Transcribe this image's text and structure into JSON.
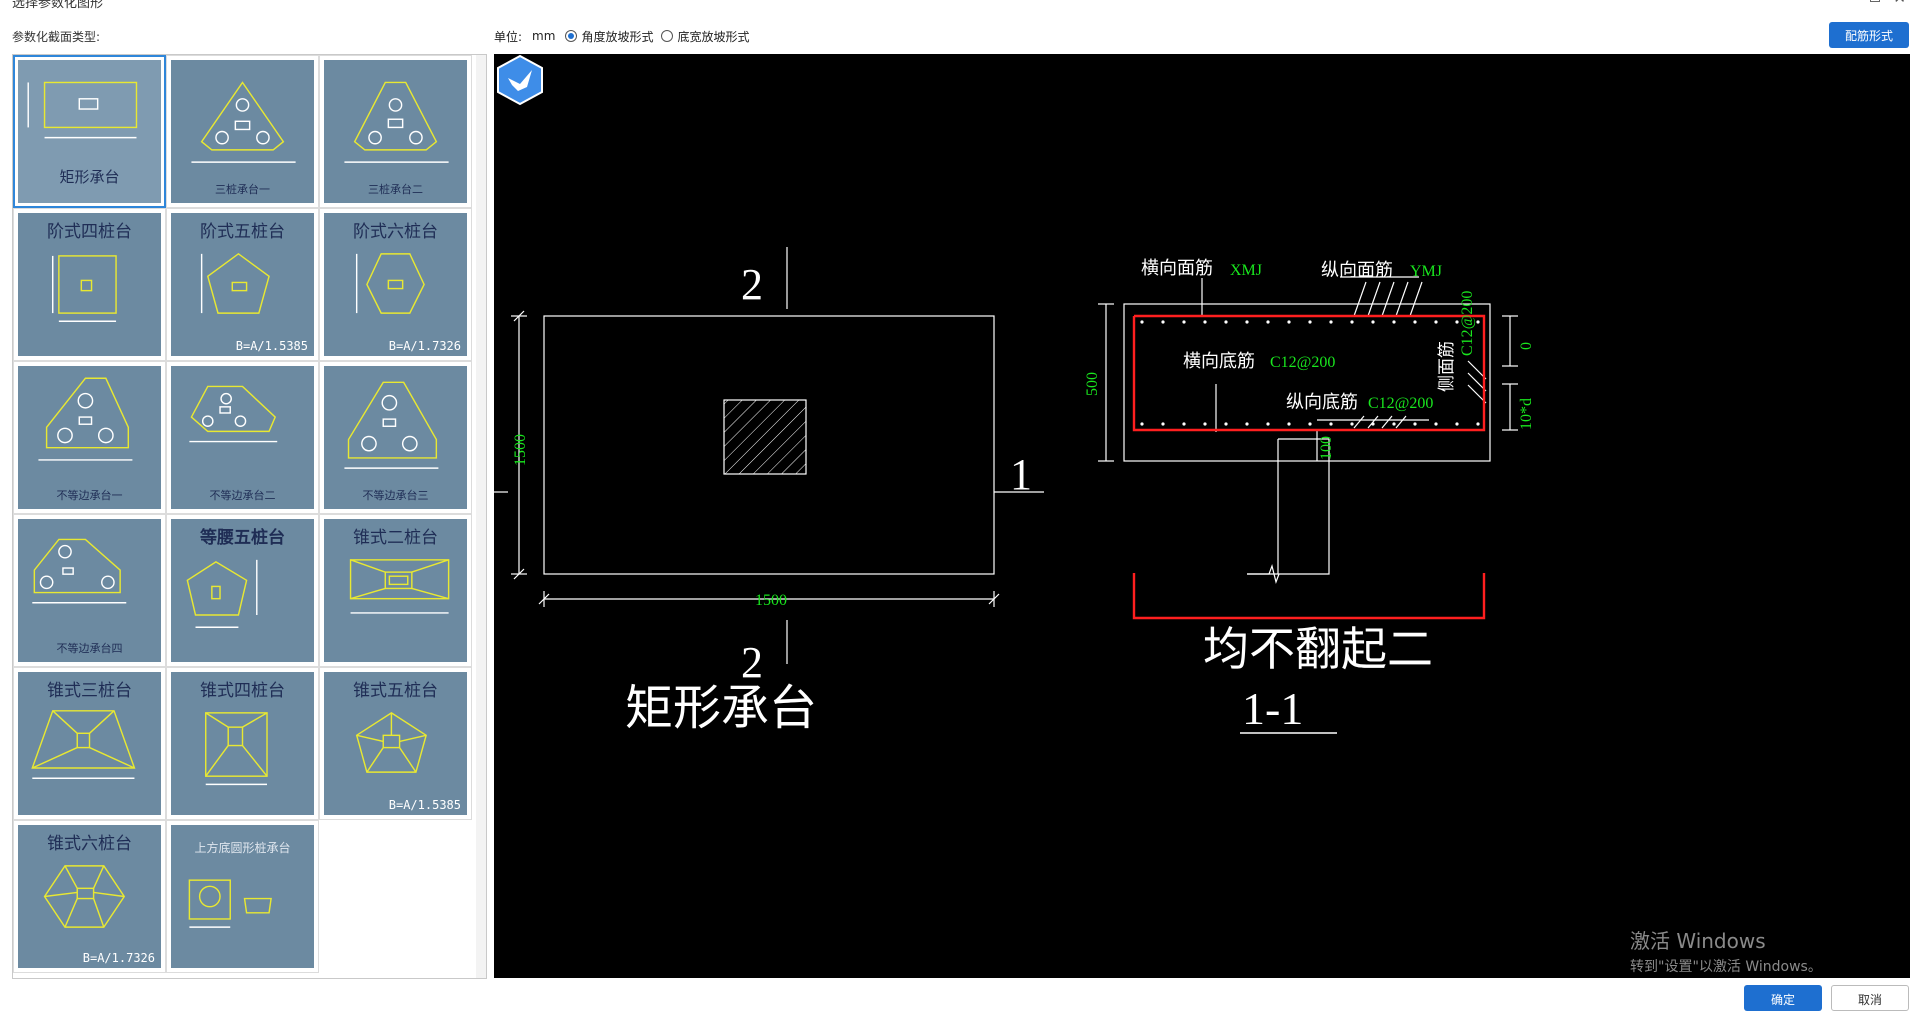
{
  "window": {
    "title": "选择参数化图形",
    "close_glyph": "✕"
  },
  "left_panel": {
    "label": "参数化截面类型:"
  },
  "gallery": [
    {
      "id": "rect",
      "label": "",
      "caption": "矩形承台",
      "formula": ""
    },
    {
      "id": "tri1",
      "label": "",
      "caption": "三桩承台一",
      "formula": ""
    },
    {
      "id": "tri2",
      "label": "",
      "caption": "三桩承台二",
      "formula": ""
    },
    {
      "id": "step4",
      "label": "阶式四桩台",
      "caption": "",
      "formula": ""
    },
    {
      "id": "step5",
      "label": "阶式五桩台",
      "caption": "",
      "formula": "B=A/1.5385"
    },
    {
      "id": "step6",
      "label": "阶式六桩台",
      "caption": "",
      "formula": "B=A/1.7326"
    },
    {
      "id": "uneq1",
      "label": "",
      "caption": "不等边承台一",
      "formula": ""
    },
    {
      "id": "uneq2",
      "label": "",
      "caption": "不等边承台二",
      "formula": ""
    },
    {
      "id": "uneq3",
      "label": "",
      "caption": "不等边承台三",
      "formula": ""
    },
    {
      "id": "uneq4",
      "label": "",
      "caption": "不等边承台四",
      "formula": ""
    },
    {
      "id": "iso5",
      "label": "等腰五桩台",
      "caption": "",
      "formula": ""
    },
    {
      "id": "cone2",
      "label": "锥式二桩台",
      "caption": "",
      "formula": ""
    },
    {
      "id": "cone3",
      "label": "锥式三桩台",
      "caption": "",
      "formula": ""
    },
    {
      "id": "cone4",
      "label": "锥式四桩台",
      "caption": "",
      "formula": ""
    },
    {
      "id": "cone5",
      "label": "锥式五桩台",
      "caption": "",
      "formula": "B=A/1.5385"
    },
    {
      "id": "cone6",
      "label": "锥式六桩台",
      "caption": "",
      "formula": "B=A/1.7326"
    },
    {
      "id": "round",
      "label": "上方底圆形桩承台",
      "caption": "",
      "formula": ""
    }
  ],
  "toolbar": {
    "unit_label": "单位:",
    "unit_value": "mm",
    "options": [
      {
        "label": "角度放坡形式",
        "checked": true
      },
      {
        "label": "底宽放坡形式",
        "checked": false
      }
    ],
    "rebar_button": "配筋形式"
  },
  "drawing": {
    "plan_title": "矩形承台",
    "section_mark_top": "2",
    "section_mark_bottom": "2",
    "section_mark_right": "1",
    "dim_height": "1500",
    "dim_width": "1500",
    "section_title": "均不翻起二",
    "section_label": "1-1",
    "rebar_top_transverse_label": "横向面筋",
    "rebar_top_transverse_code": "XMJ",
    "rebar_top_longitudinal_label": "纵向面筋",
    "rebar_top_longitudinal_code": "YMJ",
    "rebar_bottom_transverse_label": "横向底筋",
    "rebar_bottom_transverse_code": "C12@200",
    "rebar_bottom_longitudinal_label": "纵向底筋",
    "rebar_bottom_longitudinal_code": "C12@200",
    "side_rebar_label": "侧面筋",
    "side_rebar_code": "C12@200",
    "dim_section_height": "500",
    "dim_cover": "100",
    "dim_zero": "0",
    "dim_anchor": "10*d"
  },
  "watermark": {
    "title": "激活 Windows",
    "subtitle": "转到\"设置\"以激活 Windows。"
  },
  "footer": {
    "ok": "确定",
    "cancel": "取消"
  }
}
